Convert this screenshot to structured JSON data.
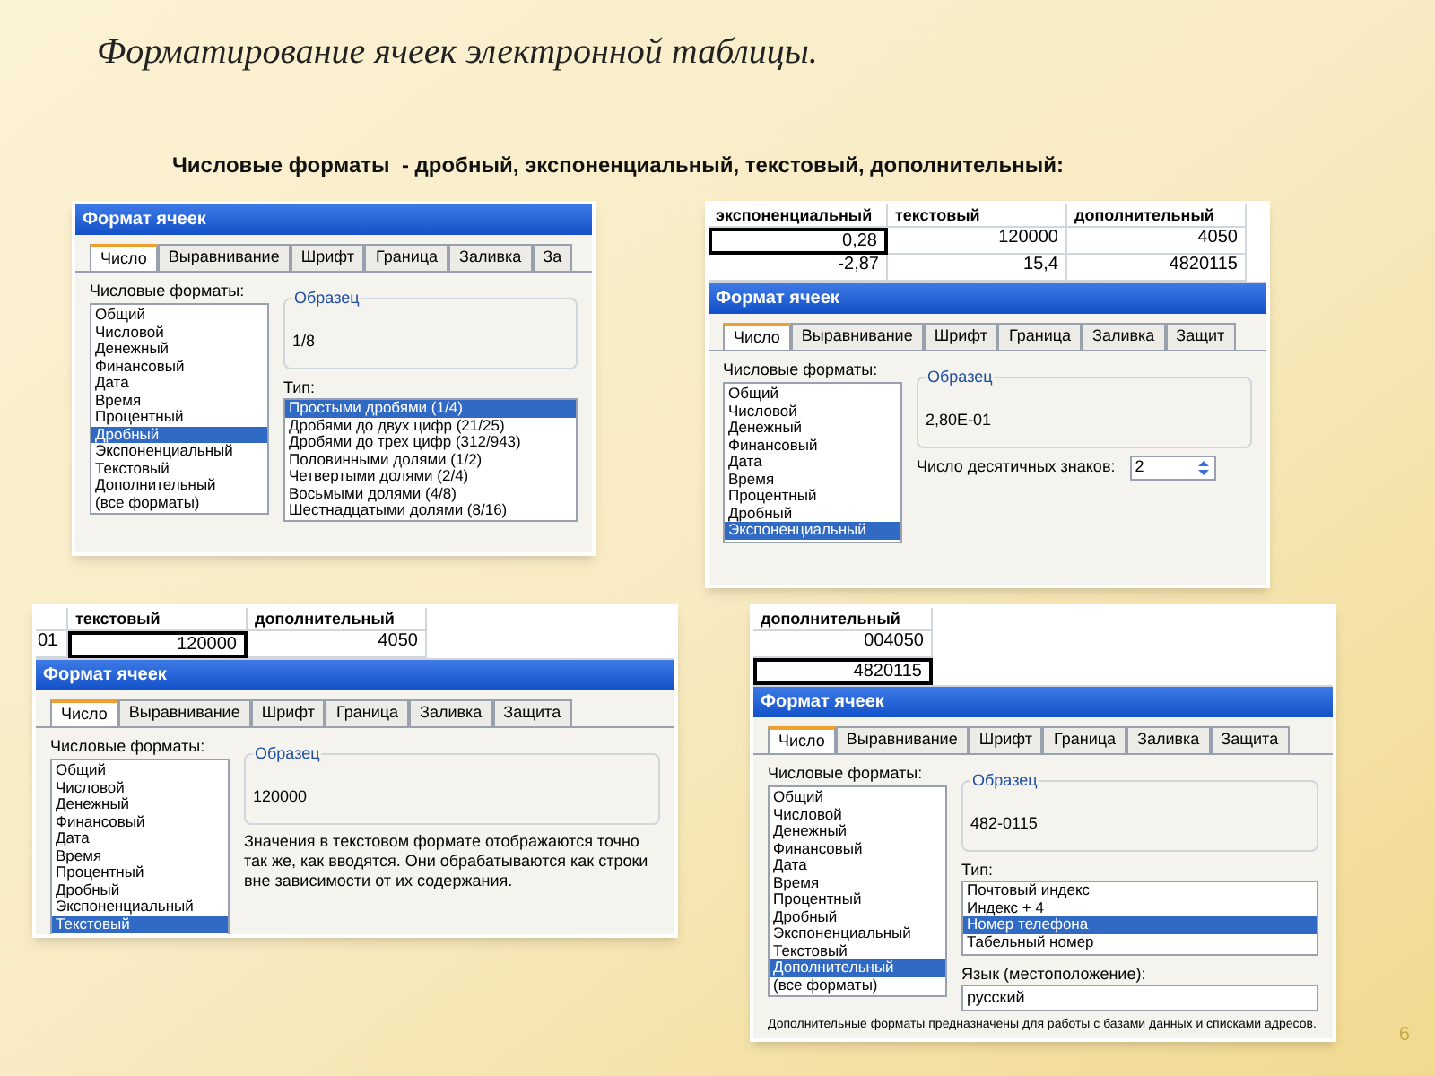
{
  "slide": {
    "title": "Форматирование ячеек электронной таблицы.",
    "subtitle": "Числовые форматы  - дробный, экспоненциальный, текстовый, дополнительный:",
    "page_number": "6"
  },
  "shots": [
    {
      "dialog": {
        "title": "Формат ячеек",
        "tabs": [
          {
            "label": "Число",
            "selected": true
          },
          {
            "label": "Выравнивание",
            "selected": false
          },
          {
            "label": "Шрифт",
            "selected": false
          },
          {
            "label": "Граница",
            "selected": false
          },
          {
            "label": "Заливка",
            "selected": false
          },
          {
            "label": "За",
            "selected": false
          }
        ],
        "formats_label": "Числовые форматы:",
        "formats": [
          {
            "label": "Общий",
            "selected": false
          },
          {
            "label": "Числовой",
            "selected": false
          },
          {
            "label": "Денежный",
            "selected": false
          },
          {
            "label": "Финансовый",
            "selected": false
          },
          {
            "label": "Дата",
            "selected": false
          },
          {
            "label": "Время",
            "selected": false
          },
          {
            "label": "Процентный",
            "selected": false
          },
          {
            "label": "Дробный",
            "selected": true
          },
          {
            "label": "Экспоненциальный",
            "selected": false
          },
          {
            "label": "Текстовый",
            "selected": false
          },
          {
            "label": "Дополнительный",
            "selected": false
          },
          {
            "label": "(все форматы)",
            "selected": false
          }
        ],
        "sample_label": "Образец",
        "sample_value": "1/8",
        "type_label": "Тип:",
        "types": [
          {
            "label": "Простыми дробями (1/4)",
            "selected": true
          },
          {
            "label": "Дробями до двух цифр (21/25)",
            "selected": false
          },
          {
            "label": "Дробями до трех цифр (312/943)",
            "selected": false
          },
          {
            "label": "Половинными долями (1/2)",
            "selected": false
          },
          {
            "label": "Четвертыми долями (2/4)",
            "selected": false
          },
          {
            "label": "Восьмыми долями (4/8)",
            "selected": false
          },
          {
            "label": "Шестнадцатыми долями (8/16)",
            "selected": false
          }
        ]
      }
    },
    {
      "grid": {
        "columns": [
          "экспоненциальный",
          "текстовый",
          "дополнительный"
        ],
        "rows": [
          {
            "cells": [
              {
                "text": "0,28",
                "selected": true
              },
              {
                "text": "120000",
                "selected": false
              },
              {
                "text": "4050",
                "selected": false
              }
            ]
          },
          {
            "cells": [
              {
                "text": "-2,87",
                "selected": false
              },
              {
                "text": "15,4",
                "selected": false
              },
              {
                "text": "4820115",
                "selected": false
              }
            ]
          }
        ]
      },
      "dialog": {
        "title": "Формат ячеек",
        "tabs": [
          {
            "label": "Число",
            "selected": true
          },
          {
            "label": "Выравнивание",
            "selected": false
          },
          {
            "label": "Шрифт",
            "selected": false
          },
          {
            "label": "Граница",
            "selected": false
          },
          {
            "label": "Заливка",
            "selected": false
          },
          {
            "label": "Защит",
            "selected": false
          }
        ],
        "formats_label": "Числовые форматы:",
        "formats": [
          {
            "label": "Общий",
            "selected": false
          },
          {
            "label": "Числовой",
            "selected": false
          },
          {
            "label": "Денежный",
            "selected": false
          },
          {
            "label": "Финансовый",
            "selected": false
          },
          {
            "label": "Дата",
            "selected": false
          },
          {
            "label": "Время",
            "selected": false
          },
          {
            "label": "Процентный",
            "selected": false
          },
          {
            "label": "Дробный",
            "selected": false
          },
          {
            "label": "Экспоненциальный",
            "selected": true
          }
        ],
        "sample_label": "Образец",
        "sample_value": "2,80E-01",
        "decimals_label": "Число десятичных знаков:",
        "decimals_value": "2"
      }
    },
    {
      "grid": {
        "columns": [
          "",
          "текстовый",
          "дополнительный"
        ],
        "rows": [
          {
            "cells": [
              {
                "text": "01",
                "selected": false
              },
              {
                "text": "120000",
                "selected": true
              },
              {
                "text": "4050",
                "selected": false
              }
            ]
          }
        ]
      },
      "dialog": {
        "title": "Формат ячеек",
        "tabs": [
          {
            "label": "Число",
            "selected": true
          },
          {
            "label": "Выравнивание",
            "selected": false
          },
          {
            "label": "Шрифт",
            "selected": false
          },
          {
            "label": "Граница",
            "selected": false
          },
          {
            "label": "Заливка",
            "selected": false
          },
          {
            "label": "Защита",
            "selected": false
          }
        ],
        "formats_label": "Числовые форматы:",
        "formats": [
          {
            "label": "Общий",
            "selected": false
          },
          {
            "label": "Числовой",
            "selected": false
          },
          {
            "label": "Денежный",
            "selected": false
          },
          {
            "label": "Финансовый",
            "selected": false
          },
          {
            "label": "Дата",
            "selected": false
          },
          {
            "label": "Время",
            "selected": false
          },
          {
            "label": "Процентный",
            "selected": false
          },
          {
            "label": "Дробный",
            "selected": false
          },
          {
            "label": "Экспоненциальный",
            "selected": false
          },
          {
            "label": "Текстовый",
            "selected": true
          }
        ],
        "sample_label": "Образец",
        "sample_value": "120000",
        "description": "Значения в текстовом формате отображаются точно так же, как вводятся. Они обрабатываются как строки вне зависимости от их содержания."
      }
    },
    {
      "grid": {
        "columns": [
          "дополнительный"
        ],
        "rows": [
          {
            "cells": [
              {
                "text": "004050",
                "selected": false
              }
            ]
          },
          {
            "cells": [
              {
                "text": "4820115",
                "selected": true
              }
            ]
          }
        ]
      },
      "dialog": {
        "title": "Формат ячеек",
        "tabs": [
          {
            "label": "Число",
            "selected": true
          },
          {
            "label": "Выравнивание",
            "selected": false
          },
          {
            "label": "Шрифт",
            "selected": false
          },
          {
            "label": "Граница",
            "selected": false
          },
          {
            "label": "Заливка",
            "selected": false
          },
          {
            "label": "Защита",
            "selected": false
          }
        ],
        "formats_label": "Числовые форматы:",
        "formats": [
          {
            "label": "Общий",
            "selected": false
          },
          {
            "label": "Числовой",
            "selected": false
          },
          {
            "label": "Денежный",
            "selected": false
          },
          {
            "label": "Финансовый",
            "selected": false
          },
          {
            "label": "Дата",
            "selected": false
          },
          {
            "label": "Время",
            "selected": false
          },
          {
            "label": "Процентный",
            "selected": false
          },
          {
            "label": "Дробный",
            "selected": false
          },
          {
            "label": "Экспоненциальный",
            "selected": false
          },
          {
            "label": "Текстовый",
            "selected": false
          },
          {
            "label": "Дополнительный",
            "selected": true
          },
          {
            "label": "(все форматы)",
            "selected": false
          }
        ],
        "sample_label": "Образец",
        "sample_value": "482-0115",
        "type_label": "Тип:",
        "types": [
          {
            "label": "Почтовый индекс",
            "selected": false
          },
          {
            "label": "Индекс + 4",
            "selected": false
          },
          {
            "label": "Номер телефона",
            "selected": true
          },
          {
            "label": "Табельный номер",
            "selected": false
          }
        ],
        "locale_label": "Язык (местоположение):",
        "locale_value": "русский",
        "footer_note": "Дополнительные форматы предназначены для работы с базами данных и списками адресов."
      }
    }
  ]
}
